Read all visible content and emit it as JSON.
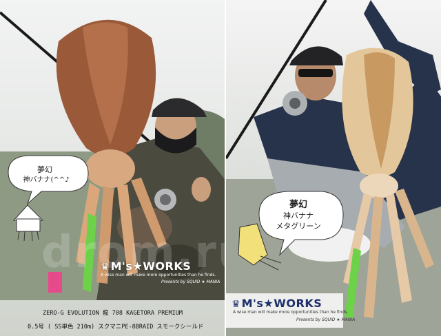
{
  "left_panel": {
    "bubble": {
      "line1": "夢幻",
      "line2": "神バナナ(^^♪"
    },
    "logo": {
      "crown": "♛",
      "text": "M's★WORKS"
    },
    "tagline": "A wise man will make more opportunities than he finds.",
    "credit": "Presents by SQUID ★ MANIA"
  },
  "right_panel": {
    "bubble": {
      "line1": "夢幻",
      "line2": "神バナナ",
      "line3": "メタグリーン"
    },
    "logo": {
      "crown": "♛",
      "text": "M's★WORKS"
    },
    "tagline": "A wise man will make more opportunities than he finds.",
    "credit": "Presents by SQUID ★ MANIA"
  },
  "caption": {
    "line1": "ZERO-G EVOLUTION 龍 708 KAGETORA PREMIUM",
    "line2": "0.5号 ( SS単色 210m) スクマニPE-8BRAID スモークシールド"
  },
  "watermark": "drom.ru",
  "colors": {
    "logo_white": "#ffffff",
    "logo_navy": "#1f2f6a",
    "squid_left": "#9a5a3a",
    "squid_right": "#e3c79a"
  }
}
